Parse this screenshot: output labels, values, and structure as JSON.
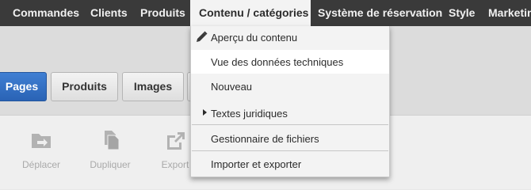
{
  "topnav": {
    "items": [
      {
        "label": "Commandes"
      },
      {
        "label": "Clients"
      },
      {
        "label": "Produits"
      },
      {
        "label": "Contenu / catégories"
      },
      {
        "label": "Système de réservation"
      },
      {
        "label": "Style"
      },
      {
        "label": "Marketing"
      }
    ],
    "active_index": 3
  },
  "tabs": [
    {
      "label": "Pages",
      "selected": true
    },
    {
      "label": "Produits",
      "selected": false
    },
    {
      "label": "Images",
      "selected": false
    }
  ],
  "actions": [
    {
      "label": "Déplacer",
      "icon": "folder-move-icon",
      "enabled": false
    },
    {
      "label": "Dupliquer",
      "icon": "duplicate-icon",
      "enabled": false
    },
    {
      "label": "Export",
      "icon": "export-icon",
      "enabled": false
    }
  ],
  "dropdown": {
    "items": [
      {
        "label": "Aperçu du contenu",
        "icon": "pencil-icon"
      },
      {
        "label": "Vue des données techniques",
        "hover": true
      },
      {
        "label": "Nouveau"
      },
      {
        "label": "Textes juridiques",
        "submenu": true
      },
      {
        "label": "Gestionnaire de fichiers"
      },
      {
        "label": "Importer et exporter"
      }
    ]
  },
  "colors": {
    "nav_bg": "#3a3a3a",
    "selected_tab": "#2f6cc0",
    "disabled_text": "#a9a9a9"
  }
}
